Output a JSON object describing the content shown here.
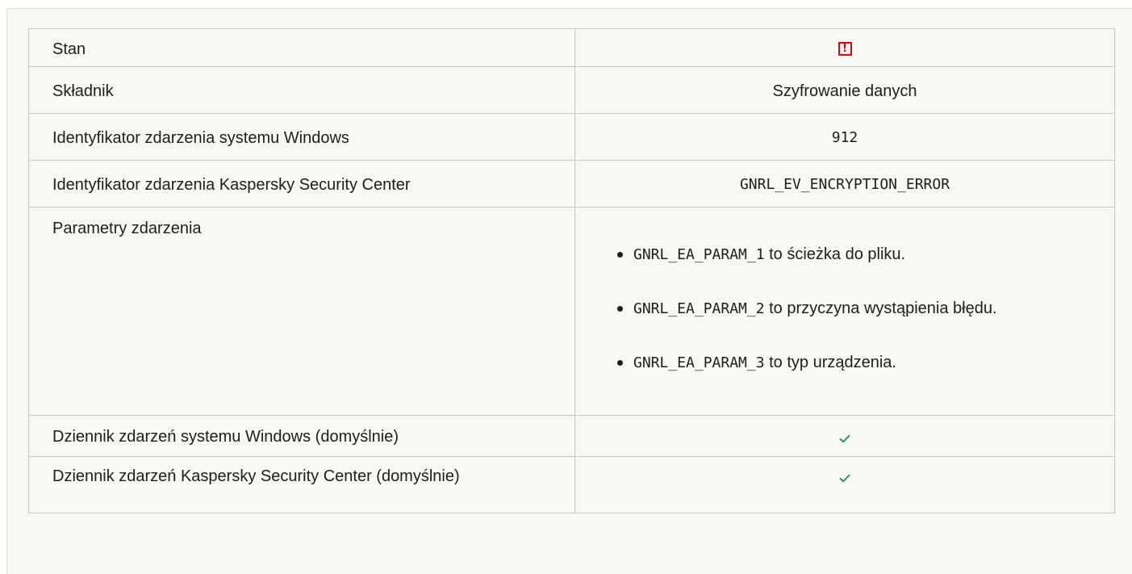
{
  "table": {
    "rows": [
      {
        "label": "Stan",
        "value_icon": "status-error-icon",
        "value_icon_glyph": "!"
      },
      {
        "label": "Składnik",
        "value": "Szyfrowanie danych"
      },
      {
        "label": "Identyfikator zdarzenia systemu Windows",
        "value": "912"
      },
      {
        "label": "Identyfikator zdarzenia Kaspersky Security Center",
        "value": "GNRL_EV_ENCRYPTION_ERROR"
      },
      {
        "label": "Parametry zdarzenia",
        "params": [
          {
            "code": "GNRL_EA_PARAM_1",
            "text": " to ścieżka do pliku."
          },
          {
            "code": "GNRL_EA_PARAM_2",
            "text": " to przyczyna wystąpienia błędu."
          },
          {
            "code": "GNRL_EA_PARAM_3",
            "text": " to typ urządzenia."
          }
        ]
      },
      {
        "label": "Dziennik zdarzeń systemu Windows (domyślnie)",
        "value_icon": "check-icon"
      },
      {
        "label": "Dziennik zdarzeń Kaspersky Security Center (domyślnie)",
        "value_icon": "check-icon"
      }
    ]
  },
  "colors": {
    "panel_bg": "#f8f8f3",
    "border": "#c8c8bf",
    "error_red": "#e10011",
    "check_green": "#1a8c6a"
  }
}
